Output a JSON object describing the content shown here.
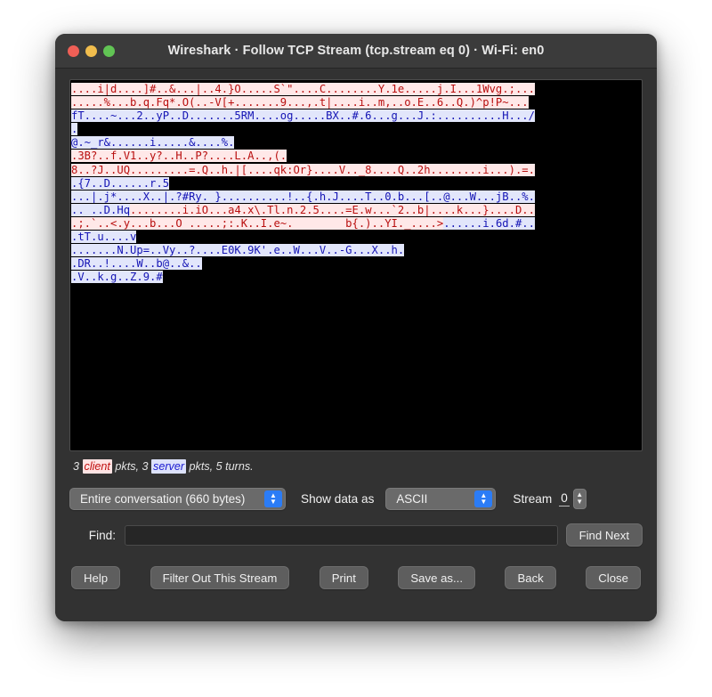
{
  "window": {
    "title": "Wireshark · Follow TCP Stream (tcp.stream eq 0) · Wi-Fi: en0",
    "traffic_lights": {
      "close": "close-button",
      "minimize": "minimize-button",
      "maximize": "maximize-button"
    }
  },
  "stream": {
    "lines": [
      [
        {
          "side": "client",
          "text": "....i|d....]#..&...|..4.}O.....S`\"....C........Y.1e.....j.I...1Wvg.;..."
        }
      ],
      [
        {
          "side": "client",
          "text": ".....%...b.q.Fq*.O(..-V[+.......9...,.t|....i..m,..o.E..6..Q.)^p!P~..."
        }
      ],
      [
        {
          "side": "server",
          "text": "fT....~...2..yP..D.......5RM....og.....BX..#.6...g...J.:..........H.../"
        }
      ],
      [
        {
          "side": "server",
          "text": "."
        }
      ],
      [
        {
          "side": "server",
          "text": "@.~_r&......i.....&....%."
        }
      ],
      [
        {
          "side": "client",
          "text": ".3B?..f.V1..y?..H..P?....L.A..,(."
        }
      ],
      [
        {
          "side": "client",
          "text": "8..?J..UQ.........=.Q..h.|[....qk:Or}....V.._8....Q..2h........i...).=."
        }
      ],
      [
        {
          "side": "server",
          "text": ".{7..D......r.5"
        }
      ],
      [
        {
          "side": "server",
          "text": "...|.j*....X..|.?#Ry. }..........!..{.h.J....T..0.b...[..@...W...jB..%."
        }
      ],
      [
        {
          "side": "server",
          "text": ".. ..D.Hq"
        },
        {
          "side": "client",
          "text": "........i.iO...a4.x\\.Tl.n.2.5....=E.w...`2..b|....k...}....D.."
        }
      ],
      [
        {
          "side": "client",
          "text": ".;.`..<.y...b...O .....;:.K..I.e~.        b{.)..YI._....>"
        },
        {
          "side": "server",
          "text": "......i.6d.#.."
        }
      ],
      [
        {
          "side": "server",
          "text": ".tT.u....v"
        }
      ],
      [
        {
          "side": "server",
          "text": ".......N.Up=..Vy..?....E0K.9K'.e..W...V..-G...X..h."
        }
      ],
      [
        {
          "side": "server",
          "text": ".DR..!....W..b@..&.."
        }
      ],
      [
        {
          "side": "server",
          "text": ".V..k.g..Z.9.#"
        }
      ]
    ]
  },
  "summary": {
    "prefix": "3 ",
    "client_word": "client",
    "middle": " pkts, 3 ",
    "server_word": "server",
    "suffix": " pkts, 5 turns."
  },
  "controls": {
    "conversation_select": {
      "value": "Entire conversation (660 bytes)",
      "options": [
        "Entire conversation (660 bytes)"
      ]
    },
    "show_data_as_label": "Show data as",
    "format_select": {
      "value": "ASCII",
      "options": [
        "ASCII"
      ]
    },
    "stream_label": "Stream",
    "stream_value": "0",
    "stepper_up": "▲",
    "stepper_down": "▼",
    "chevron_up": "▲",
    "chevron_down": "▼"
  },
  "find": {
    "label": "Find:",
    "value": "",
    "placeholder": "",
    "find_next_label": "Find Next"
  },
  "buttons": {
    "help": "Help",
    "filter_out": "Filter Out This Stream",
    "print": "Print",
    "save_as": "Save as...",
    "back": "Back",
    "close": "Close"
  },
  "colors": {
    "client_text": "#b80f0f",
    "client_bg": "#ffe8e8",
    "server_text": "#1414b4",
    "server_bg": "#e2e6fb",
    "pane_bg": "#000000",
    "window_bg": "#323232",
    "accent": "#2b7cf6"
  }
}
